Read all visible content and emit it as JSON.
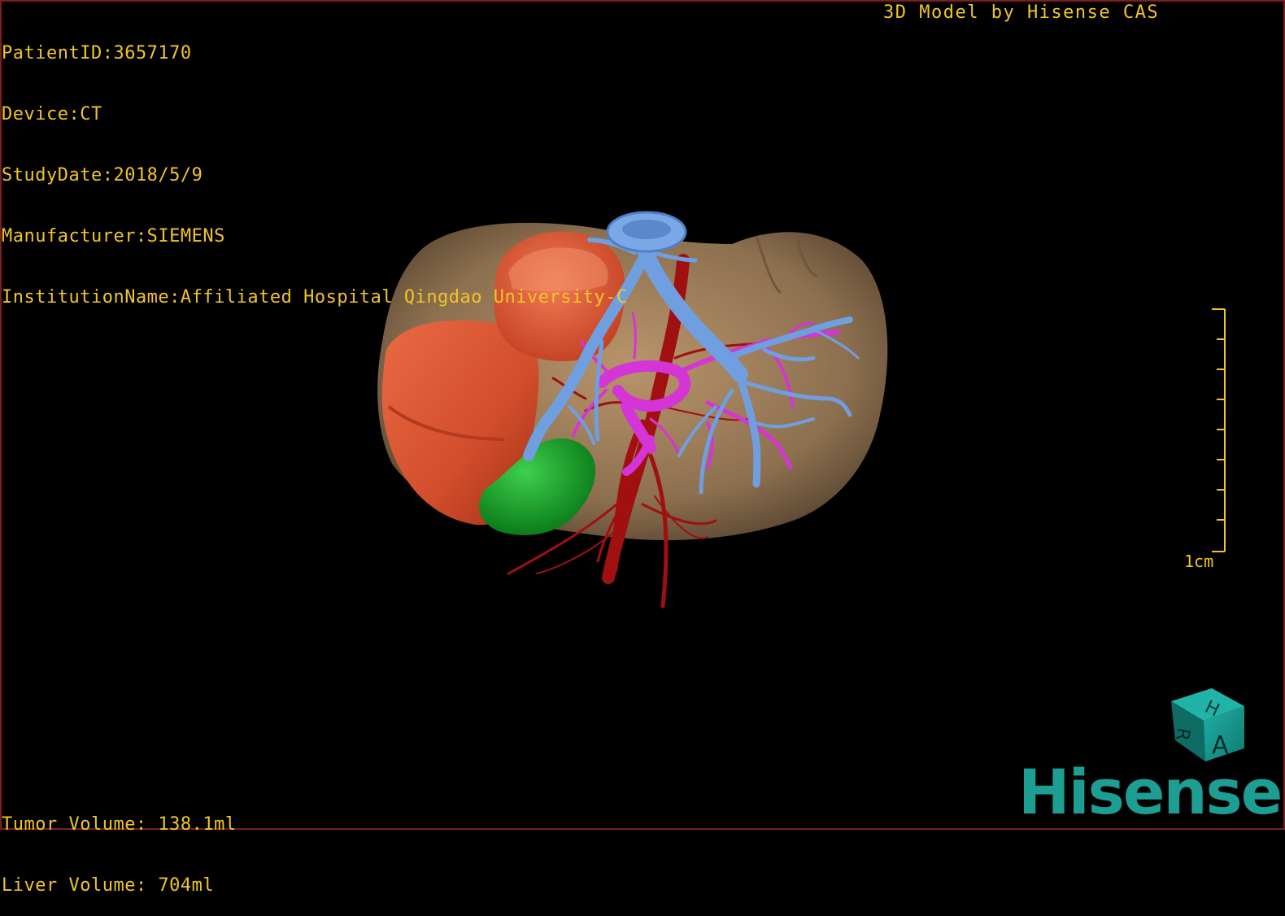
{
  "patient_info": {
    "patient_id": "PatientID:3657170",
    "device": "Device:CT",
    "study_date": "StudyDate:2018/5/9",
    "manufacturer": "Manufacturer:SIEMENS",
    "institution": "InstitutionName:Affiliated Hospital Qingdao University-C"
  },
  "watermark": "3D Model by Hisense CAS",
  "volumes": {
    "tumor": "Tumor Volume: 138.1ml",
    "liver": "Liver Volume: 704ml"
  },
  "scale_bar": {
    "label": "1cm"
  },
  "orientation_cube": {
    "face_top": "H",
    "face_left": "R",
    "face_front": "A"
  },
  "brand": "Hisense",
  "colors": {
    "overlay_text": "#f0c528",
    "liver": "#9a7a55",
    "tumor": "#d9502e",
    "portal_vein": "#6f9fe0",
    "hepatic_vein": "#d534d6",
    "artery": "#a01010",
    "gallbladder": "#16a02a",
    "brand": "#1c9e93"
  }
}
